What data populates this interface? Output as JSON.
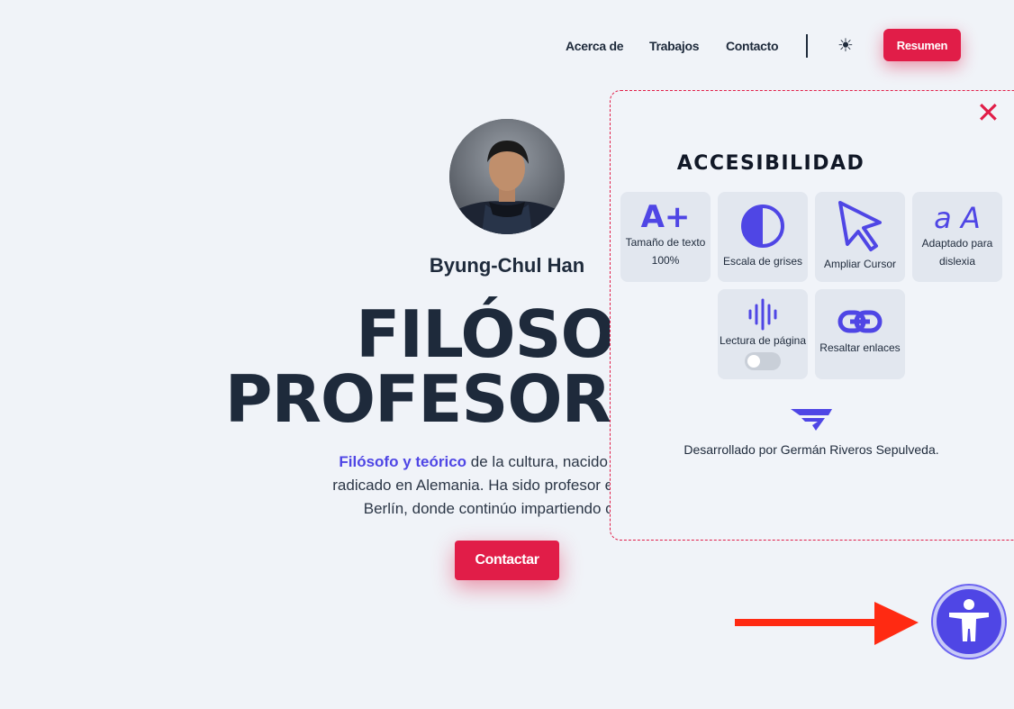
{
  "nav": {
    "links": [
      "Acerca de",
      "Trabajos",
      "Contacto"
    ],
    "theme_icon": "sun-icon",
    "resume_label": "Resumen"
  },
  "hero": {
    "name": "Byung-Chul Han",
    "title_line1": "FILÓSOF",
    "title_line2": "PROFESOR Y ES",
    "desc_highlight": "Filósofo y teórico",
    "desc_line1_rest": " de la cultura, nacido en Corea",
    "desc_line2": "radicado en Alemania. Ha sido profesor en la Unive",
    "desc_line3": "Berlín, donde continúo impartiendo cursos",
    "contact_label": "Contactar"
  },
  "accessibility": {
    "title": "ACCESIBILIDAD",
    "close_icon": "close-icon",
    "tiles": {
      "text_size": {
        "label": "Tamaño de texto",
        "value": "100%",
        "icon_text": "A+"
      },
      "grayscale": {
        "label": "Escala de grises"
      },
      "cursor": {
        "label": "Ampliar Cursor"
      },
      "dyslexia": {
        "label_line1": "Adaptado para",
        "label_line2": "dislexia",
        "icon_text": "a A"
      },
      "reading": {
        "label": "Lectura de página",
        "toggle_on": false
      },
      "links": {
        "label": "Resaltar enlaces"
      }
    },
    "developer_text": "Desarrollado por Germán Riveros Sepulveda."
  },
  "colors": {
    "accent": "#e11d48",
    "primary": "#4f46e5",
    "text": "#1e2a3b",
    "background": "#f0f3f8"
  },
  "fab_icon": "accessibility-person-icon"
}
